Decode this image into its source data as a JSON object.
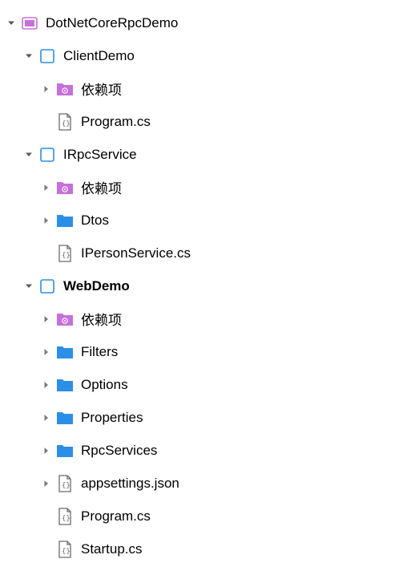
{
  "tree": {
    "solution": "DotNetCoreRpcDemo",
    "clientDemo": {
      "name": "ClientDemo",
      "deps": "依赖项",
      "program": "Program.cs"
    },
    "iRpcService": {
      "name": "IRpcService",
      "deps": "依赖项",
      "dtos": "Dtos",
      "iPerson": "IPersonService.cs"
    },
    "webDemo": {
      "name": "WebDemo",
      "deps": "依赖项",
      "filters": "Filters",
      "options": "Options",
      "properties": "Properties",
      "rpcServices": "RpcServices",
      "appsettings": "appsettings.json",
      "program": "Program.cs",
      "startup": "Startup.cs"
    }
  }
}
